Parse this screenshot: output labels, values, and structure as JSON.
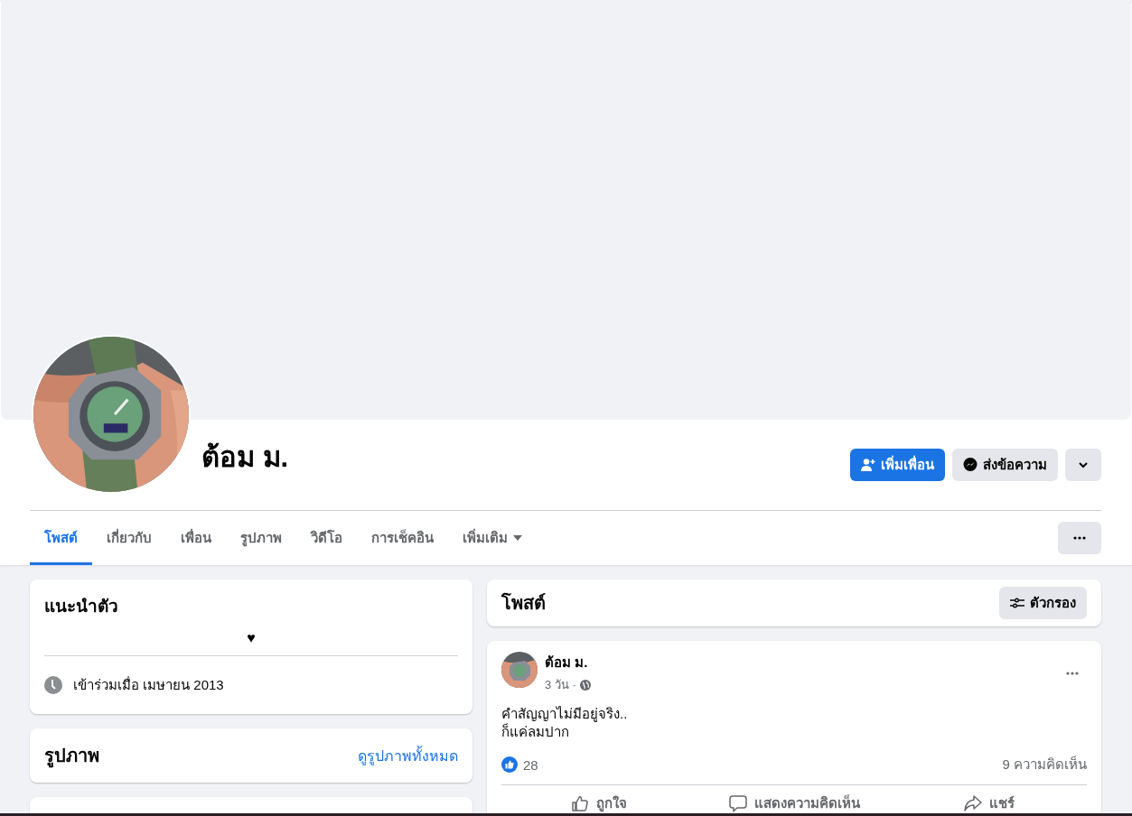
{
  "profile": {
    "name": "ต้อม ม.",
    "actions": [
      {
        "kind": "add-friend",
        "label": "เพิ่มเพื่อน"
      },
      {
        "kind": "message",
        "label": "ส่งข้อความ"
      },
      {
        "kind": "dropdown"
      }
    ]
  },
  "tabs": [
    {
      "label": "โพสต์",
      "selected": true,
      "dropdown": false
    },
    {
      "label": "เกี่ยวกับ",
      "selected": false,
      "dropdown": false
    },
    {
      "label": "เพื่อน",
      "selected": false,
      "dropdown": false
    },
    {
      "label": "รูปภาพ",
      "selected": false,
      "dropdown": false
    },
    {
      "label": "วิดีโอ",
      "selected": false,
      "dropdown": false
    },
    {
      "label": "การเช็คอิน",
      "selected": false,
      "dropdown": false
    },
    {
      "label": "เพิ่มเติม",
      "selected": false,
      "dropdown": true
    }
  ],
  "intro": {
    "title": "แนะนำตัว",
    "bio": "♥",
    "joined": "เข้าร่วมเมื่อ เมษายน 2013"
  },
  "photos": {
    "title": "รูปภาพ",
    "link": "ดูรูปภาพทั้งหมด"
  },
  "posts_header": {
    "title": "โพสต์",
    "filter": "ตัวกรอง"
  },
  "post": {
    "author": "ต้อม ม.",
    "time": "3 วัน ·",
    "lines": [
      "คำสัญญาไม่มีอยู่จริง..",
      "ก็แค่ลมปาก"
    ],
    "likes": "28",
    "comments": "9 ความคิดเห็น",
    "actions": [
      {
        "kind": "like",
        "label": "ถูกใจ"
      },
      {
        "kind": "comment",
        "label": "แสดงความคิดเห็น"
      },
      {
        "kind": "share",
        "label": "แชร์"
      }
    ]
  }
}
